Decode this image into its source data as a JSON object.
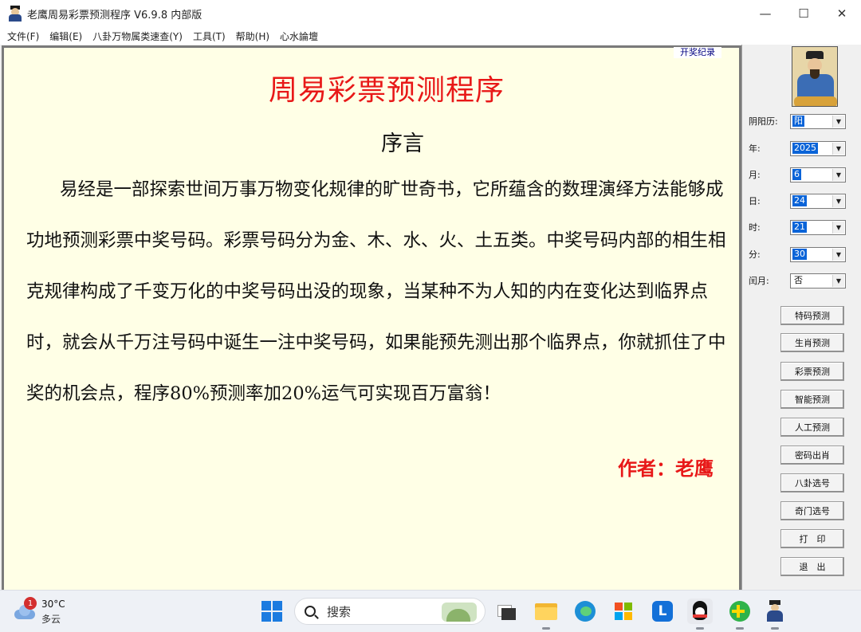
{
  "window": {
    "title": "老鹰周易彩票预测程序 V6.9.8 内部版",
    "controls": {
      "minimize": "—",
      "maximize": "☐",
      "close": "✕"
    }
  },
  "menu": [
    "文件(F)",
    "编辑(E)",
    "八卦万物属类速查(Y)",
    "工具(T)",
    "帮助(H)",
    "心水論壇"
  ],
  "content": {
    "record_tab": "开奖纪录",
    "main_title": "周易彩票预测程序",
    "preface_title": "序言",
    "paragraph": "易经是一部探索世间万事万物变化规律的旷世奇书，它所蕴含的数理演绎方法能够成功地预测彩票中奖号码。彩票号码分为金、木、水、火、土五类。中奖号码内部的相生相克规律构成了千变万化的中奖号码出没的现象，当某种不为人知的内在变化达到临界点时，就会从千万注号码中诞生一注中奖号码，如果能预先测出那个临界点，你就抓住了中奖的机会点，程序80%预测率加20%运气可实现百万富翁！",
    "author": "作者：老鹰"
  },
  "sidebar": {
    "fields": [
      {
        "label": "阴阳历:",
        "value": "阳"
      },
      {
        "label": "年:",
        "value": "2025"
      },
      {
        "label": "月:",
        "value": "6"
      },
      {
        "label": "日:",
        "value": "24"
      },
      {
        "label": "时:",
        "value": "21"
      },
      {
        "label": "分:",
        "value": "30"
      },
      {
        "label": "闰月:",
        "value": "否"
      }
    ],
    "buttons": [
      "特码预测",
      "生肖预测",
      "彩票预测",
      "智能预测",
      "人工预测",
      "密码出肖",
      "八卦选号",
      "奇门选号",
      "打　印",
      "退　出"
    ]
  },
  "taskbar": {
    "weather": {
      "badge": "1",
      "temp": "30°C",
      "condition": "多云"
    },
    "search_placeholder": "搜索"
  }
}
